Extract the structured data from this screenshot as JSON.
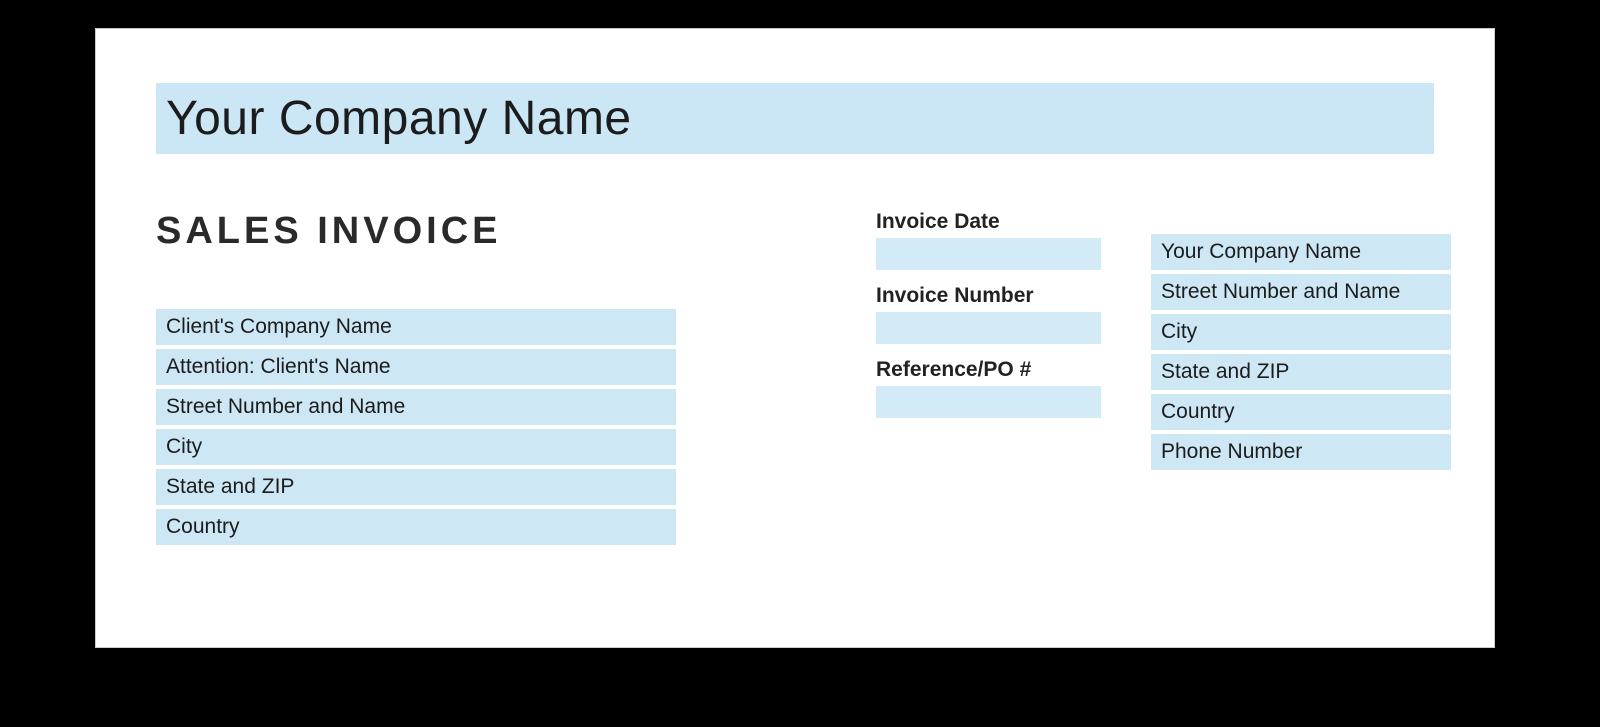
{
  "header": {
    "company_name": "Your Company Name"
  },
  "document": {
    "title": "SALES INVOICE"
  },
  "client": {
    "lines": [
      "Client's Company Name",
      "Attention: Client's Name",
      "Street Number and Name",
      "City",
      "State and ZIP",
      "Country"
    ]
  },
  "meta": {
    "invoice_date_label": "Invoice Date",
    "invoice_date_value": "",
    "invoice_number_label": "Invoice Number",
    "invoice_number_value": "",
    "reference_label": "Reference/PO #",
    "reference_value": ""
  },
  "company_details": {
    "lines": [
      "Your Company Name",
      "Street Number and Name",
      "City",
      "State and ZIP",
      "Country",
      "Phone Number"
    ]
  }
}
